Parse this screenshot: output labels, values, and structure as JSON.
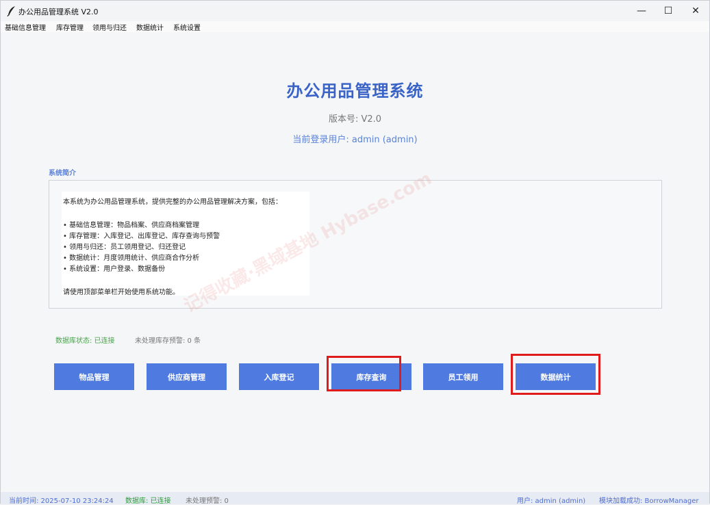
{
  "window": {
    "title": "办公用品管理系统 V2.0",
    "controls": {
      "minimize": "—",
      "maximize": "☐",
      "close": "✕"
    }
  },
  "menu": [
    "基础信息管理",
    "库存管理",
    "领用与归还",
    "数据统计",
    "系统设置"
  ],
  "header": {
    "title": "办公用品管理系统",
    "version": "版本号: V2.0",
    "login_user": "当前登录用户: admin (admin)"
  },
  "intro": {
    "label": "系统简介",
    "lines": [
      "本系统为办公用品管理系统，提供完整的办公用品管理解决方案，包括：",
      "",
      "• 基础信息管理：物品档案、供应商档案管理",
      "• 库存管理：入库登记、出库登记、库存查询与预警",
      "• 领用与归还：员工领用登记、归还登记",
      "• 数据统计：月度领用统计、供应商合作分析",
      "• 系统设置：用户登录、数据备份",
      "",
      "请使用顶部菜单栏开始使用系统功能。"
    ]
  },
  "status": {
    "db": "数据库状态: 已连接",
    "warn": "未处理库存预警: 0 条"
  },
  "buttons": [
    "物品管理",
    "供应商管理",
    "入库登记",
    "库存查询",
    "员工领用",
    "数据统计"
  ],
  "watermark": "记得收藏·黑域基地 Hybase.com",
  "statusbar": {
    "time": "当前时间: 2025-07-10 23:24:24",
    "db": "数据库: 已连接",
    "warn": "未处理预警: 0",
    "user": "用户: admin (admin)",
    "module": "模块加载成功: BorrowManager"
  },
  "colors": {
    "accent": "#4f7be0",
    "title": "#3a63c8",
    "success": "#46a546",
    "highlight": "#e01b1b"
  }
}
